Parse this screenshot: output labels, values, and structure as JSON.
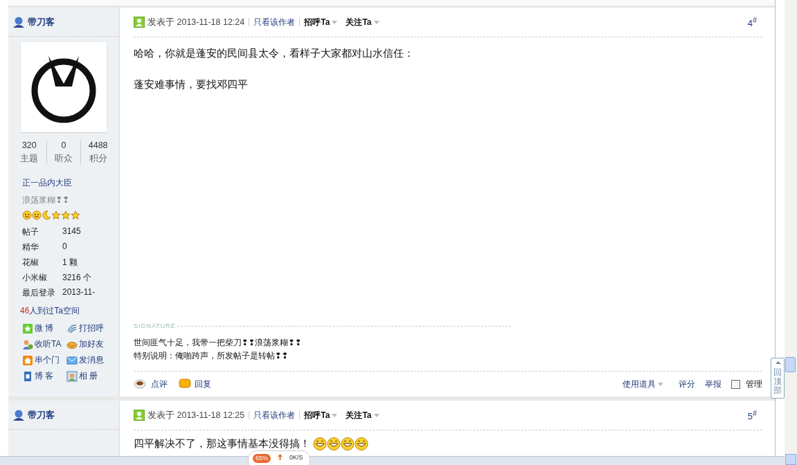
{
  "posts": [
    {
      "author": {
        "name": "带刀客",
        "stats": [
          {
            "value": "320",
            "label": "主题"
          },
          {
            "value": "0",
            "label": "听众"
          },
          {
            "value": "4488",
            "label": "积分"
          }
        ],
        "rank": "正一品内大臣",
        "status": "浪荡浆糊❢❢",
        "rank_icons": [
          {
            "kind": "sun"
          },
          {
            "kind": "sun"
          },
          {
            "kind": "moon"
          },
          {
            "kind": "star"
          },
          {
            "kind": "star"
          },
          {
            "kind": "star"
          }
        ],
        "fields": [
          {
            "label": "帖子",
            "value": "3145"
          },
          {
            "label": "精华",
            "value": "0"
          },
          {
            "label": "花椒",
            "value": "1 颗"
          },
          {
            "label": "小米椒",
            "value": "3216 个"
          },
          {
            "label": "最后登录",
            "value": "2013-11-"
          }
        ],
        "visit_count": "46",
        "visit_text": "人到过Ta空间",
        "actions": [
          {
            "kind": "weibo",
            "label": "微 博"
          },
          {
            "kind": "greet",
            "label": "打招呼"
          },
          {
            "kind": "listen",
            "label": "收听TA"
          },
          {
            "kind": "friend",
            "label": "加好友"
          },
          {
            "kind": "home",
            "label": "串个门"
          },
          {
            "kind": "message",
            "label": "发消息"
          },
          {
            "kind": "blog",
            "label": "博 客"
          },
          {
            "kind": "album",
            "label": "相 册"
          }
        ]
      },
      "posted": "发表于 2013-11-18 12:24",
      "only_author": "只看该作者",
      "greet": "招呼Ta",
      "follow": "关注Ta",
      "floor": "4$^{#}$",
      "body": [
        "哈哈，你就是蓬安的民间县太令，看样子大家都对山水信任：",
        "蓬安难事情，要找邓四平"
      ],
      "signature_label": "SIGNATURE",
      "signature": [
        "世间匪气十足，我带一把柴刀❢❢浪荡浆糊❢❢",
        "特别说明：俺啪跨声，所发帖子是转帖❢❢"
      ],
      "footer": {
        "comment": "点评",
        "reply": "回复",
        "tools": "使用道具",
        "rate": "评分",
        "report": "举报",
        "manage": "管理",
        "manage_checked": false
      }
    },
    {
      "author": {
        "name": "带刀客"
      },
      "posted": "发表于 2013-11-18 12:25",
      "only_author": "只看该作者",
      "greet": "招呼Ta",
      "follow": "关注Ta",
      "floor": "5$^{#}$",
      "body": [
        "四平解决不了，那这事情基本没得搞！"
      ],
      "emoticons": [
        {
          "kind": "grin"
        },
        {
          "kind": "grin"
        },
        {
          "kind": "grin"
        },
        {
          "kind": "grin"
        }
      ]
    }
  ],
  "back_to_top": "回顶部",
  "speed_widget": {
    "percent": "65%",
    "speed": "0K/S"
  }
}
